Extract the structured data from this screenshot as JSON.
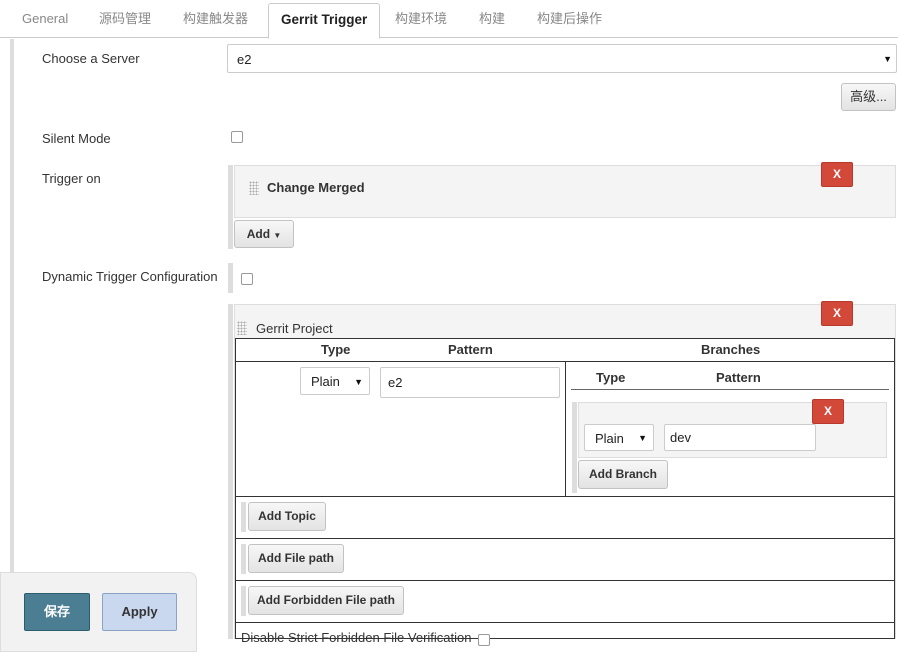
{
  "tabs": [
    {
      "label": "General"
    },
    {
      "label": "源码管理"
    },
    {
      "label": "构建触发器"
    },
    {
      "label": "Gerrit Trigger"
    },
    {
      "label": "构建环境"
    },
    {
      "label": "构建"
    },
    {
      "label": "构建后操作"
    }
  ],
  "active_tab": "Gerrit Trigger",
  "server": {
    "label": "Choose a Server",
    "value": "e2"
  },
  "advanced_button": "高级...",
  "silent_mode": {
    "label": "Silent Mode",
    "checked": false
  },
  "trigger_on": {
    "label": "Trigger on",
    "event": "Change Merged",
    "delete_label": "X",
    "add_label": "Add"
  },
  "dynamic_trigger": {
    "label": "Dynamic Trigger Configuration",
    "checked": false
  },
  "gerrit_project": {
    "title": "Gerrit Project",
    "delete_label": "X",
    "headers": {
      "type": "Type",
      "pattern": "Pattern",
      "branches": "Branches"
    },
    "type_value": "Plain",
    "pattern_value": "e2",
    "branches": {
      "headers": {
        "type": "Type",
        "pattern": "Pattern"
      },
      "items": [
        {
          "type": "Plain",
          "pattern": "dev",
          "delete_label": "X"
        }
      ],
      "add_branch_label": "Add Branch"
    },
    "add_topic_label": "Add Topic",
    "add_file_path_label": "Add File path",
    "add_forbidden_label": "Add Forbidden File path",
    "disable_strict_label": "Disable Strict Forbidden File Verification"
  },
  "colors": {
    "delete": "#d24939",
    "save": "#4b7d93",
    "apply": "#c9d8ef"
  },
  "footer": {
    "save_label": "保存",
    "apply_label": "Apply"
  }
}
